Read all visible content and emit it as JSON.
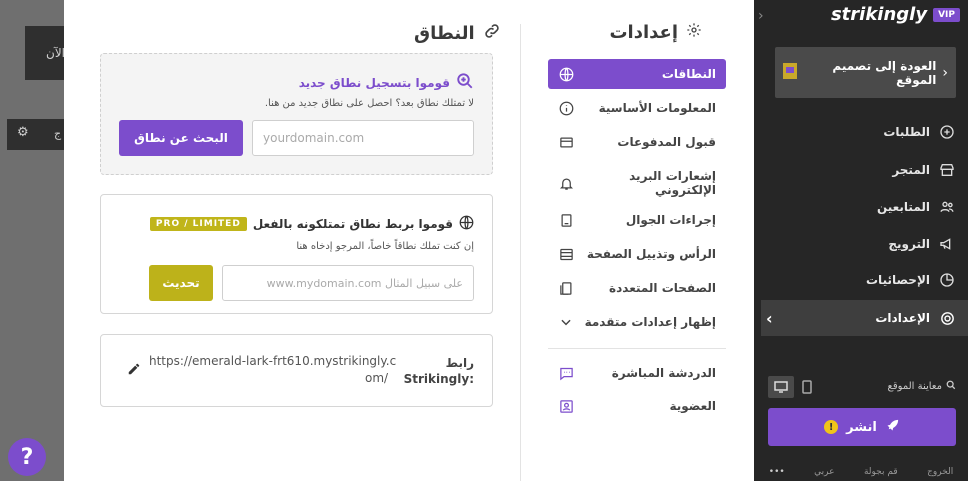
{
  "backdrop": {
    "text1": "الآن",
    "text2": "ج"
  },
  "help": {
    "label": "?"
  },
  "settings": {
    "title": "إعدادات",
    "nav": [
      {
        "label": "النطاقات",
        "icon": "globe-icon",
        "active": true
      },
      {
        "label": "المعلومات الأساسية",
        "icon": "info-icon"
      },
      {
        "label": "قبول المدفوعات",
        "icon": "payment-icon"
      },
      {
        "label": "إشعارات البريد الإلكتروني",
        "icon": "bell-icon"
      },
      {
        "label": "إجراءات الجوال",
        "icon": "mobile-icon"
      },
      {
        "label": "الرأس وتذييل الصفحة",
        "icon": "header-footer-icon"
      },
      {
        "label": "الصفحات المتعددة",
        "icon": "pages-icon"
      },
      {
        "label": "إظهار إعدادات متقدمة",
        "icon": "chevron-down-icon"
      },
      {
        "label": "الدردشة المباشرة",
        "icon": "chat-icon"
      },
      {
        "label": "العضوية",
        "icon": "membership-icon"
      }
    ]
  },
  "domain": {
    "title": "النطاق",
    "register": {
      "heading": "قوموا بتسجيل نطاق جديد",
      "sub": "لا تمتلك نطاق بعد؟ احصل على نطاق جديد من هنا.",
      "placeholder": "yourdomain.com",
      "button": "البحث عن نطاق"
    },
    "connect": {
      "heading": "قوموا بربط نطاق تمتلكونه بالفعل",
      "badge": "PRO / LIMITED",
      "sub": "إن كنت تملك نطاقاً خاصاً، المرجو إدخاه هنا",
      "placeholder": "على سبيل المثال www.mydomain.com",
      "button": "تحديث"
    },
    "link": {
      "label_line1": "رابط",
      "label_line2": "Strikingly:",
      "url_line1": "https://emerald-lark-frt610.mystrikingly.c",
      "url_line2": "om/"
    }
  },
  "sidebar": {
    "vip": "VIP",
    "brand": "strikingly",
    "back": "العودة إلى تصميم الموقع",
    "items": [
      {
        "label": "الطلبات",
        "icon": "orders-icon"
      },
      {
        "label": "المتجر",
        "icon": "store-icon"
      },
      {
        "label": "المتابعين",
        "icon": "followers-icon"
      },
      {
        "label": "الترويج",
        "icon": "megaphone-icon"
      },
      {
        "label": "الإحصائيات",
        "icon": "stats-icon"
      },
      {
        "label": "الإعدادات",
        "icon": "gear-icon"
      }
    ],
    "preview": "معاينة الموقع",
    "publish": "انشر",
    "footer": [
      "الخروج",
      "قم بجولة",
      "عربي",
      "•••"
    ]
  }
}
